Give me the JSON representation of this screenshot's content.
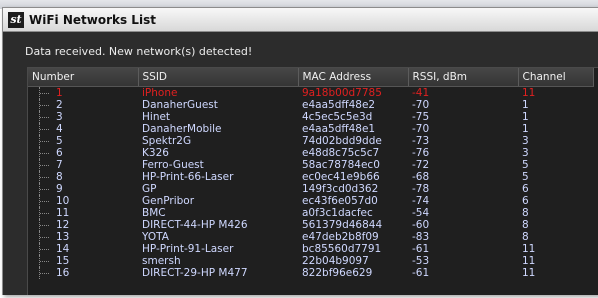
{
  "window": {
    "title": "WiFi Networks List",
    "logo_text": "st"
  },
  "status": "Data received. New network(s) detected!",
  "columns": [
    "Number",
    "SSID",
    "MAC Address",
    "RSSI, dBm",
    "Channel"
  ],
  "rows": [
    {
      "number": "1",
      "ssid": "iPhone",
      "mac": "9a18b00d7785",
      "rssi": "-41",
      "channel": "11",
      "highlight": true
    },
    {
      "number": "2",
      "ssid": "DanaherGuest",
      "mac": "e4aa5dff48e2",
      "rssi": "-70",
      "channel": "1"
    },
    {
      "number": "3",
      "ssid": "Hinet",
      "mac": "4c5ec5c5e3d",
      "rssi": "-75",
      "channel": "1"
    },
    {
      "number": "4",
      "ssid": "DanaherMobile",
      "mac": "e4aa5dff48e1",
      "rssi": "-70",
      "channel": "1"
    },
    {
      "number": "5",
      "ssid": "Spektr2G",
      "mac": "74d02bdd9dde",
      "rssi": "-73",
      "channel": "3"
    },
    {
      "number": "6",
      "ssid": "K326",
      "mac": "e48d8c75c5c7",
      "rssi": "-76",
      "channel": "3"
    },
    {
      "number": "7",
      "ssid": "Ferro-Guest",
      "mac": "58ac78784ec0",
      "rssi": "-72",
      "channel": "5"
    },
    {
      "number": "8",
      "ssid": "HP-Print-66-Laser",
      "mac": "ec0ec41e9b66",
      "rssi": "-68",
      "channel": "5"
    },
    {
      "number": "9",
      "ssid": "GP",
      "mac": "149f3cd0d362",
      "rssi": "-78",
      "channel": "6"
    },
    {
      "number": "10",
      "ssid": "GenPribor",
      "mac": "ec43f6e057d0",
      "rssi": "-74",
      "channel": "6"
    },
    {
      "number": "11",
      "ssid": "BMC",
      "mac": "a0f3c1dacfec",
      "rssi": "-54",
      "channel": "8"
    },
    {
      "number": "12",
      "ssid": "DIRECT-44-HP M426",
      "mac": "561379d46844",
      "rssi": "-60",
      "channel": "8"
    },
    {
      "number": "13",
      "ssid": "YOTA",
      "mac": "e47deb2b8f09",
      "rssi": "-83",
      "channel": "8"
    },
    {
      "number": "14",
      "ssid": "HP-Print-91-Laser",
      "mac": "bc85560d7791",
      "rssi": "-61",
      "channel": "11"
    },
    {
      "number": "15",
      "ssid": "smersh",
      "mac": "22b04b9097",
      "rssi": "-53",
      "channel": "11"
    },
    {
      "number": "16",
      "ssid": "DIRECT-29-HP M477",
      "mac": "822bf96e629",
      "rssi": "-61",
      "channel": "11"
    }
  ],
  "colors": {
    "row_text": "#cfd8ff",
    "alert_text": "#e02020",
    "panel_bg": "#2c2c2c"
  }
}
